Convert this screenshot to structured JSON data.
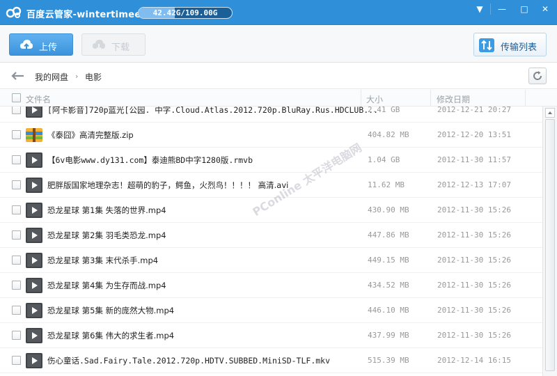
{
  "window": {
    "title": "百度云管家-wintertimee",
    "quota_text": "42.42G/109.00G",
    "quota_fraction": 0.389,
    "controls": {
      "menu": "▼",
      "minimize": "—",
      "maximize": "□",
      "close": "✕"
    },
    "accent_color": "#2f8fd9"
  },
  "toolbar": {
    "upload_label": "上传",
    "download_label": "下载",
    "transfer_label": "传输列表"
  },
  "breadcrumb": {
    "root": "我的网盘",
    "separator": "›",
    "current": "电影"
  },
  "list_header": {
    "name": "文件名",
    "size": "大小",
    "date": "修改日期"
  },
  "files": [
    {
      "name": "[阿卡影音]720p蓝光[公园. 中字.Cloud.Atlas.2012.720p.BluRay.Rus.HDCLUB...",
      "size": "2.41 GB",
      "date": "2012-12-21 20:27",
      "icon": "video-icon"
    },
    {
      "name": "《泰囧》高清完整版.zip",
      "size": "404.82 MB",
      "date": "2012-12-20 13:51",
      "icon": "archive-icon"
    },
    {
      "name": "【6v电影www.dy131.com】泰迪熊BD中字1280版.rmvb",
      "size": "1.04 GB",
      "date": "2012-11-30 11:57",
      "icon": "video-icon"
    },
    {
      "name": "肥胖版国家地理杂志！超萌的豹子，鳄鱼，火烈鸟！！！！ 高清.avi",
      "size": "11.62 MB",
      "date": "2012-12-13 17:07",
      "icon": "video-icon"
    },
    {
      "name": "恐龙星球 第1集 失落的世界.mp4",
      "size": "430.90 MB",
      "date": "2012-11-30 15:26",
      "icon": "video-icon"
    },
    {
      "name": "恐龙星球 第2集 羽毛类恐龙.mp4",
      "size": "447.86 MB",
      "date": "2012-11-30 15:26",
      "icon": "video-icon"
    },
    {
      "name": "恐龙星球 第3集 末代杀手.mp4",
      "size": "449.15 MB",
      "date": "2012-11-30 15:26",
      "icon": "video-icon"
    },
    {
      "name": "恐龙星球 第4集 为生存而战.mp4",
      "size": "434.52 MB",
      "date": "2012-11-30 15:26",
      "icon": "video-icon"
    },
    {
      "name": "恐龙星球 第5集 新的庞然大物.mp4",
      "size": "446.10 MB",
      "date": "2012-11-30 15:26",
      "icon": "video-icon"
    },
    {
      "name": "恐龙星球 第6集 伟大的求生者.mp4",
      "size": "437.99 MB",
      "date": "2012-11-30 15:26",
      "icon": "video-icon"
    },
    {
      "name": "伤心童话.Sad.Fairy.Tale.2012.720p.HDTV.SUBBED.MiniSD-TLF.mkv",
      "size": "515.39 MB",
      "date": "2012-12-14 16:15",
      "icon": "video-icon"
    }
  ],
  "watermark": "PConline 太平洋电脑网"
}
